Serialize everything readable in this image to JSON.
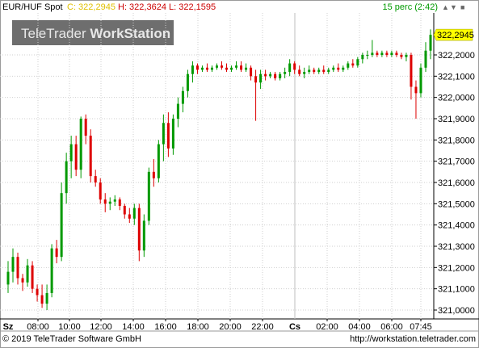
{
  "header": {
    "symbol": "EUR/HUF Spot",
    "close_label": "C: 322,2945",
    "high_label": "H: 322,3624",
    "low_label": "L: 322,1595",
    "interval": "15 perc (2:42)"
  },
  "watermark": {
    "text_light": "TeleTrader ",
    "text_bold": "WorkStation"
  },
  "price_marker": "322,2945",
  "footer": {
    "left": "© 2019 TeleTrader Software GmbH",
    "right": "http://workstation.teletrader.com"
  },
  "colors": {
    "up": "#009900",
    "down": "#dd0000",
    "marker_bg": "#ffff00",
    "watermark_bg": "#6e6e6e"
  },
  "chart_data": {
    "type": "candlestick",
    "title": "EUR/HUF Spot",
    "interval": "15 perc",
    "y_ticks": [
      "322,2000",
      "322,1000",
      "322,0000",
      "321,9000",
      "321,8000",
      "321,7000",
      "321,6000",
      "321,5000",
      "321,4000",
      "321,3000",
      "321,2000",
      "321,1000",
      "321,0000"
    ],
    "ylim": [
      320.98,
      322.36
    ],
    "x_day_labels": [
      "Sz",
      "Cs"
    ],
    "x_time_labels": [
      "08:00",
      "10:00",
      "12:00",
      "14:00",
      "16:00",
      "18:00",
      "20:00",
      "22:00",
      "02:00",
      "04:00",
      "06:00",
      "07:45"
    ],
    "last": 322.2945,
    "high": 322.3624,
    "low": 322.1595,
    "candles": [
      {
        "o": 321.12,
        "h": 321.23,
        "l": 321.08,
        "c": 321.18
      },
      {
        "o": 321.18,
        "h": 321.29,
        "l": 321.13,
        "c": 321.25
      },
      {
        "o": 321.25,
        "h": 321.27,
        "l": 321.12,
        "c": 321.15
      },
      {
        "o": 321.15,
        "h": 321.17,
        "l": 321.09,
        "c": 321.13
      },
      {
        "o": 321.13,
        "h": 321.24,
        "l": 321.11,
        "c": 321.21
      },
      {
        "o": 321.21,
        "h": 321.23,
        "l": 321.08,
        "c": 321.1
      },
      {
        "o": 321.1,
        "h": 321.12,
        "l": 321.04,
        "c": 321.07
      },
      {
        "o": 321.07,
        "h": 321.12,
        "l": 321.01,
        "c": 321.03
      },
      {
        "o": 321.03,
        "h": 321.12,
        "l": 321.0,
        "c": 321.08
      },
      {
        "o": 321.08,
        "h": 321.31,
        "l": 321.06,
        "c": 321.29
      },
      {
        "o": 321.29,
        "h": 321.33,
        "l": 321.22,
        "c": 321.25
      },
      {
        "o": 321.25,
        "h": 321.6,
        "l": 321.23,
        "c": 321.55
      },
      {
        "o": 321.55,
        "h": 321.74,
        "l": 321.5,
        "c": 321.7
      },
      {
        "o": 321.7,
        "h": 321.82,
        "l": 321.62,
        "c": 321.78
      },
      {
        "o": 321.78,
        "h": 321.82,
        "l": 321.63,
        "c": 321.66
      },
      {
        "o": 321.66,
        "h": 321.91,
        "l": 321.62,
        "c": 321.9
      },
      {
        "o": 321.9,
        "h": 321.92,
        "l": 321.78,
        "c": 321.82
      },
      {
        "o": 321.82,
        "h": 321.85,
        "l": 321.6,
        "c": 321.63
      },
      {
        "o": 321.63,
        "h": 321.66,
        "l": 321.58,
        "c": 321.6
      },
      {
        "o": 321.6,
        "h": 321.62,
        "l": 321.5,
        "c": 321.52
      },
      {
        "o": 321.52,
        "h": 321.55,
        "l": 321.46,
        "c": 321.5
      },
      {
        "o": 321.5,
        "h": 321.53,
        "l": 321.47,
        "c": 321.51
      },
      {
        "o": 321.51,
        "h": 321.54,
        "l": 321.49,
        "c": 321.52
      },
      {
        "o": 321.52,
        "h": 321.53,
        "l": 321.47,
        "c": 321.49
      },
      {
        "o": 321.49,
        "h": 321.5,
        "l": 321.43,
        "c": 321.45
      },
      {
        "o": 321.45,
        "h": 321.48,
        "l": 321.41,
        "c": 321.43
      },
      {
        "o": 321.43,
        "h": 321.5,
        "l": 321.4,
        "c": 321.48
      },
      {
        "o": 321.48,
        "h": 321.5,
        "l": 321.23,
        "c": 321.28
      },
      {
        "o": 321.28,
        "h": 321.45,
        "l": 321.25,
        "c": 321.42
      },
      {
        "o": 321.42,
        "h": 321.67,
        "l": 321.4,
        "c": 321.65
      },
      {
        "o": 321.65,
        "h": 321.71,
        "l": 321.58,
        "c": 321.62
      },
      {
        "o": 321.62,
        "h": 321.8,
        "l": 321.6,
        "c": 321.78
      },
      {
        "o": 321.78,
        "h": 321.92,
        "l": 321.7,
        "c": 321.88
      },
      {
        "o": 321.88,
        "h": 321.93,
        "l": 321.72,
        "c": 321.76
      },
      {
        "o": 321.76,
        "h": 321.92,
        "l": 321.73,
        "c": 321.9
      },
      {
        "o": 321.9,
        "h": 322.0,
        "l": 321.86,
        "c": 321.97
      },
      {
        "o": 321.97,
        "h": 322.05,
        "l": 321.93,
        "c": 322.03
      },
      {
        "o": 322.03,
        "h": 322.13,
        "l": 322.0,
        "c": 322.11
      },
      {
        "o": 322.11,
        "h": 322.17,
        "l": 322.07,
        "c": 322.15
      },
      {
        "o": 322.15,
        "h": 322.16,
        "l": 322.11,
        "c": 322.13
      },
      {
        "o": 322.13,
        "h": 322.15,
        "l": 322.12,
        "c": 322.14
      },
      {
        "o": 322.14,
        "h": 322.16,
        "l": 322.12,
        "c": 322.13
      },
      {
        "o": 322.13,
        "h": 322.15,
        "l": 322.12,
        "c": 322.14
      },
      {
        "o": 322.14,
        "h": 322.16,
        "l": 322.13,
        "c": 322.15
      },
      {
        "o": 322.15,
        "h": 322.17,
        "l": 322.13,
        "c": 322.14
      },
      {
        "o": 322.14,
        "h": 322.16,
        "l": 322.12,
        "c": 322.13
      },
      {
        "o": 322.13,
        "h": 322.15,
        "l": 322.12,
        "c": 322.14
      },
      {
        "o": 322.14,
        "h": 322.17,
        "l": 322.13,
        "c": 322.15
      },
      {
        "o": 322.15,
        "h": 322.17,
        "l": 322.12,
        "c": 322.13
      },
      {
        "o": 322.13,
        "h": 322.16,
        "l": 322.12,
        "c": 322.14
      },
      {
        "o": 322.14,
        "h": 322.15,
        "l": 322.08,
        "c": 322.1
      },
      {
        "o": 322.1,
        "h": 322.13,
        "l": 321.89,
        "c": 322.07
      },
      {
        "o": 322.07,
        "h": 322.13,
        "l": 322.04,
        "c": 322.11
      },
      {
        "o": 322.11,
        "h": 322.13,
        "l": 322.08,
        "c": 322.1
      },
      {
        "o": 322.1,
        "h": 322.12,
        "l": 322.09,
        "c": 322.11
      },
      {
        "o": 322.11,
        "h": 322.12,
        "l": 322.08,
        "c": 322.09
      },
      {
        "o": 322.09,
        "h": 322.12,
        "l": 322.08,
        "c": 322.11
      },
      {
        "o": 322.11,
        "h": 322.14,
        "l": 322.09,
        "c": 322.12
      },
      {
        "o": 322.12,
        "h": 322.18,
        "l": 322.1,
        "c": 322.16
      },
      {
        "o": 322.16,
        "h": 322.17,
        "l": 322.11,
        "c": 322.13
      },
      {
        "o": 322.13,
        "h": 322.15,
        "l": 322.1,
        "c": 322.11
      },
      {
        "o": 322.11,
        "h": 322.14,
        "l": 322.09,
        "c": 322.12
      },
      {
        "o": 322.12,
        "h": 322.15,
        "l": 322.11,
        "c": 322.13
      },
      {
        "o": 322.13,
        "h": 322.14,
        "l": 322.11,
        "c": 322.12
      },
      {
        "o": 322.12,
        "h": 322.14,
        "l": 322.11,
        "c": 322.13
      },
      {
        "o": 322.13,
        "h": 322.15,
        "l": 322.11,
        "c": 322.12
      },
      {
        "o": 322.12,
        "h": 322.14,
        "l": 322.11,
        "c": 322.13
      },
      {
        "o": 322.13,
        "h": 322.15,
        "l": 322.12,
        "c": 322.14
      },
      {
        "o": 322.14,
        "h": 322.16,
        "l": 322.12,
        "c": 322.13
      },
      {
        "o": 322.13,
        "h": 322.15,
        "l": 322.12,
        "c": 322.14
      },
      {
        "o": 322.14,
        "h": 322.17,
        "l": 322.13,
        "c": 322.16
      },
      {
        "o": 322.16,
        "h": 322.18,
        "l": 322.14,
        "c": 322.15
      },
      {
        "o": 322.15,
        "h": 322.19,
        "l": 322.14,
        "c": 322.18
      },
      {
        "o": 322.18,
        "h": 322.21,
        "l": 322.16,
        "c": 322.2
      },
      {
        "o": 322.2,
        "h": 322.22,
        "l": 322.18,
        "c": 322.2
      },
      {
        "o": 322.2,
        "h": 322.27,
        "l": 322.19,
        "c": 322.21
      },
      {
        "o": 322.21,
        "h": 322.22,
        "l": 322.19,
        "c": 322.2
      },
      {
        "o": 322.2,
        "h": 322.22,
        "l": 322.19,
        "c": 322.21
      },
      {
        "o": 322.21,
        "h": 322.22,
        "l": 322.19,
        "c": 322.2
      },
      {
        "o": 322.2,
        "h": 322.22,
        "l": 322.19,
        "c": 322.21
      },
      {
        "o": 322.21,
        "h": 322.22,
        "l": 322.19,
        "c": 322.2
      },
      {
        "o": 322.2,
        "h": 322.21,
        "l": 322.18,
        "c": 322.19
      },
      {
        "o": 322.19,
        "h": 322.21,
        "l": 322.17,
        "c": 322.2
      },
      {
        "o": 322.2,
        "h": 322.21,
        "l": 321.99,
        "c": 322.05
      },
      {
        "o": 322.05,
        "h": 322.08,
        "l": 321.9,
        "c": 322.02
      },
      {
        "o": 322.02,
        "h": 322.16,
        "l": 322.0,
        "c": 322.14
      },
      {
        "o": 322.14,
        "h": 322.26,
        "l": 322.12,
        "c": 322.22
      },
      {
        "o": 322.22,
        "h": 322.32,
        "l": 322.18,
        "c": 322.2945
      }
    ]
  }
}
